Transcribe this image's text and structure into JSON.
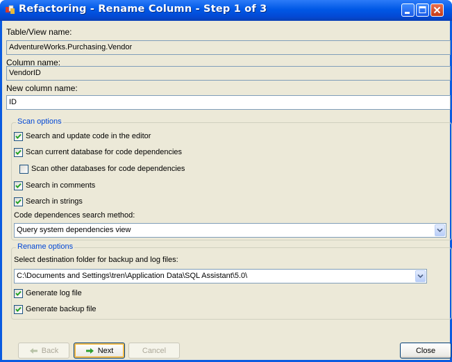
{
  "window": {
    "title": "Refactoring - Rename Column - Step 1 of 3"
  },
  "fields": {
    "table_view_label": "Table/View name:",
    "table_view_value": "AdventureWorks.Purchasing.Vendor",
    "column_label": "Column name:",
    "column_value": "VendorID",
    "new_column_label": "New column name:",
    "new_column_value": "ID"
  },
  "scan_options": {
    "title": "Scan options",
    "items": [
      {
        "label": "Search and update code in the editor",
        "checked": true
      },
      {
        "label": "Scan current database for code dependencies",
        "checked": true
      },
      {
        "label": "Scan other databases for code dependencies",
        "checked": false
      },
      {
        "label": "Search in comments",
        "checked": true
      },
      {
        "label": "Search in strings",
        "checked": true
      }
    ],
    "method_label": "Code dependences search method:",
    "method_value": "Query system dependencies view"
  },
  "rename_options": {
    "title": "Rename options",
    "folder_label": "Select destination folder for backup and log files:",
    "folder_value": "C:\\Documents and Settings\\tren\\Application Data\\SQL Assistant\\5.0\\",
    "items": [
      {
        "label": "Generate log file",
        "checked": true
      },
      {
        "label": "Generate backup file",
        "checked": true
      }
    ]
  },
  "buttons": {
    "back": "Back",
    "next": "Next",
    "cancel": "Cancel",
    "close": "Close"
  },
  "colors": {
    "titlebar": "#0058E6",
    "dialog_bg": "#ECE9D8",
    "group_title": "#0046D5"
  }
}
